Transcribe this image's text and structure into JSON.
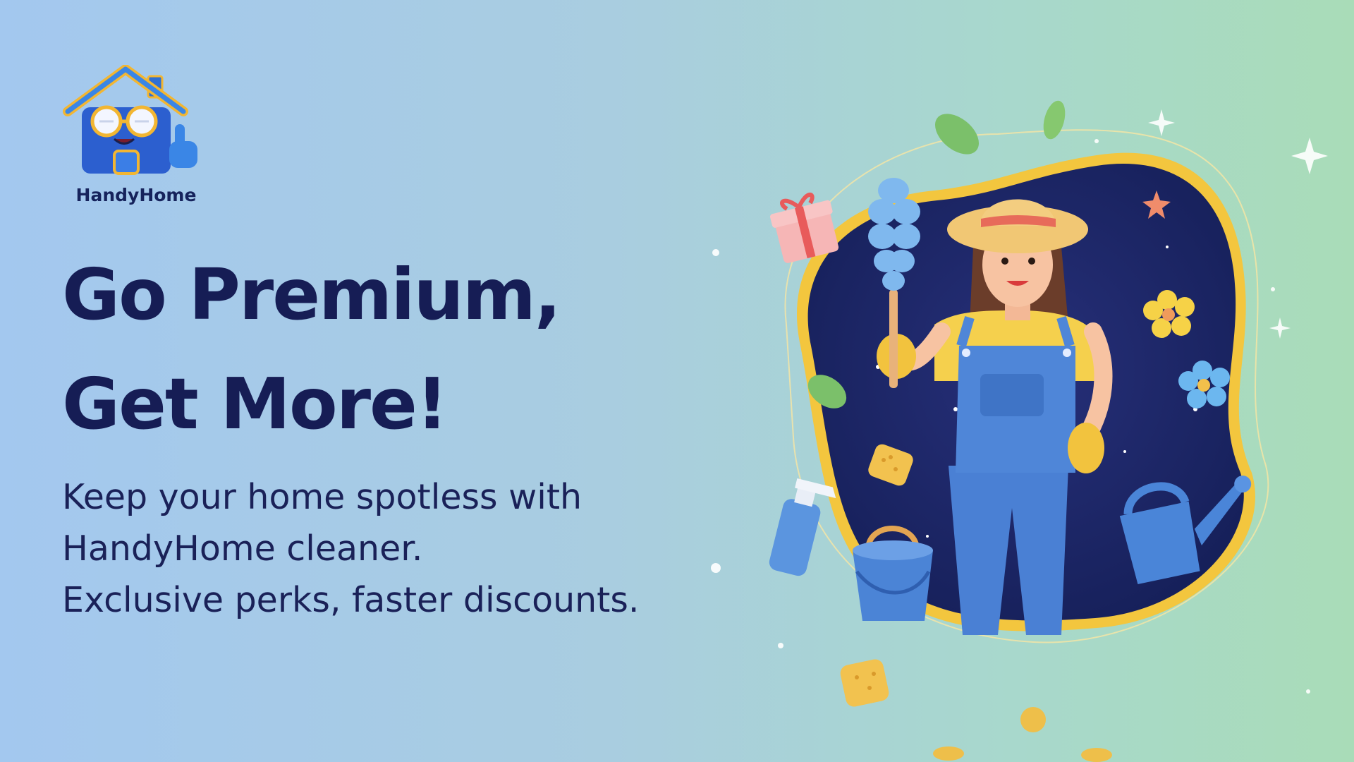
{
  "brand": {
    "name": "HandyHome",
    "logo_icon": "house-mascot-thumbs-up-icon"
  },
  "hero": {
    "headline_line1": "Go Premium,",
    "headline_line2": "Get More!",
    "body_line1": "Keep your home spotless with",
    "body_line2": "HandyHome cleaner.",
    "body_line3": "Exclusive perks, faster discounts."
  },
  "illustration": {
    "subject": "cleaner-woman-illustration",
    "props": [
      "feather-duster-icon",
      "spray-bottle-icon",
      "bucket-icon",
      "watering-can-icon",
      "gift-box-icon",
      "sponge-icon",
      "flower-icon",
      "leaf-icon",
      "sparkle-icon"
    ]
  },
  "colors": {
    "headline": "#161d55",
    "portal": "#1b2460",
    "portal_ring": "#f4cc4a",
    "overalls": "#4f86d8",
    "shirt": "#f5d04d"
  }
}
